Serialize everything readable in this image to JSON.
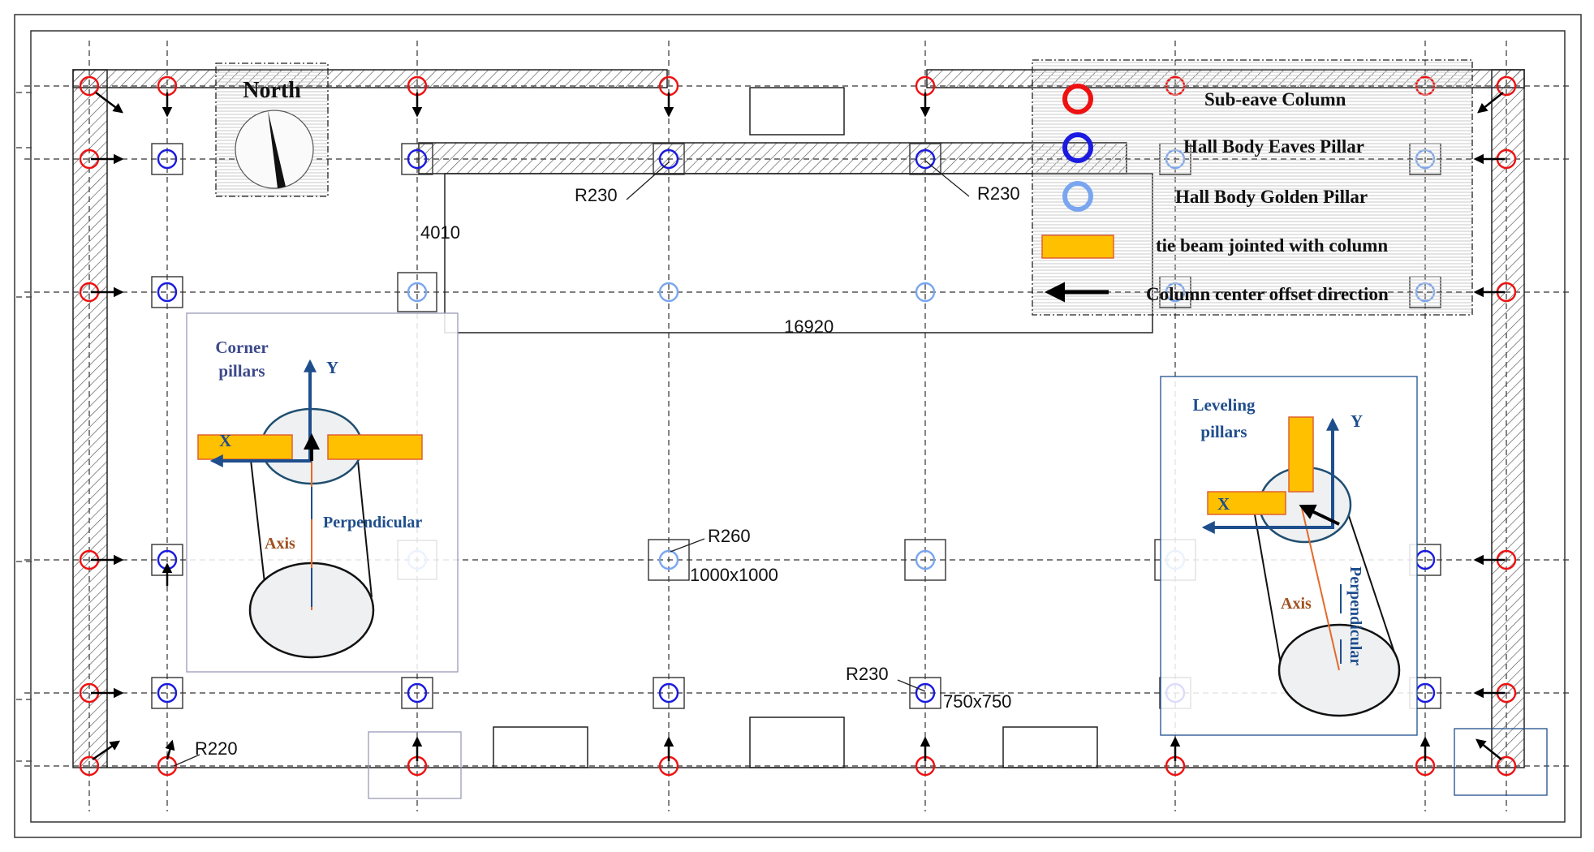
{
  "north_label": "North",
  "legend": [
    {
      "key": "sub_eave",
      "label": "Sub-eave Column",
      "color": "#ee1111",
      "icon": "red-ring-icon"
    },
    {
      "key": "eaves",
      "label": "Hall Body Eaves Pillar",
      "color": "#1a1ae0",
      "icon": "blue-ring-icon"
    },
    {
      "key": "golden",
      "label": "Hall Body Golden Pillar",
      "color": "#7aa6f0",
      "icon": "light-blue-ring-icon"
    },
    {
      "key": "beam",
      "label": "tie beam jointed with column",
      "color": "#ffc000",
      "icon": "orange-bar-icon"
    },
    {
      "key": "offset",
      "label": "Column center offset direction",
      "color": "#000000",
      "icon": "arrow-left-icon"
    }
  ],
  "dimensions": {
    "d4010": "4010",
    "d16920": "16920",
    "r230_a": "R230",
    "r230_b": "R230",
    "r230_c": "R230",
    "r260": "R260",
    "r220": "R220",
    "s1000": "1000x1000",
    "s750": "750x750"
  },
  "corner_inset": {
    "title_line1": "Corner",
    "title_line2": "pillars",
    "y_label": "Y",
    "x_label": "X",
    "axis_label": "Axis",
    "perp_label": "Perpendicular"
  },
  "leveling_inset": {
    "title_line1": "Leveling",
    "title_line2": "pillars",
    "y_label": "Y",
    "x_label": "X",
    "axis_label": "Axis",
    "perp_label": "Perpendicular"
  },
  "colors": {
    "red": "#ee1111",
    "blue": "#1a1ae0",
    "light_blue": "#7aa6f0",
    "beam": "#ffc000",
    "navy": "#1f4e8c",
    "axis_brown": "#a0501e",
    "title_purple": "#3d4a8a"
  }
}
